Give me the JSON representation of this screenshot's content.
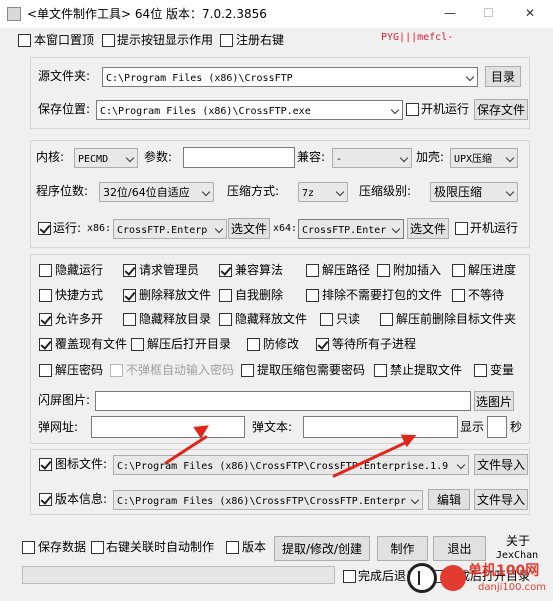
{
  "window": {
    "title": "<单文件制作工具> 64位 版本：7.0.2.3856",
    "watermark": "PYG|||mefcl-",
    "controls": {
      "minimize": "—",
      "maximize": "☐",
      "close": "✕"
    }
  },
  "top_options": {
    "topmost": "本窗口置顶",
    "tooltip": "提示按钮显示作用",
    "register_menu": "注册右键"
  },
  "source": {
    "source_label": "源文件夹:",
    "source_value": "C:\\Program Files (x86)\\CrossFTP",
    "browse_button": "目录",
    "save_label": "保存位置:",
    "save_value": "C:\\Program Files (x86)\\CrossFTP.exe",
    "autorun_label": "开机运行",
    "save_button": "保存文件"
  },
  "core": {
    "kernel_label": "内核:",
    "kernel_value": "PECMD",
    "params_label": "参数:",
    "params_value": "",
    "compat_label": "兼容:",
    "compat_value": "-",
    "shell_label": "加壳:",
    "shell_value": "UPX压缩",
    "bits_label": "程序位数:",
    "bits_value": "32位/64位自适应",
    "compress_label": "压缩方式:",
    "compress_value": "7z",
    "level_label": "压缩级别:",
    "level_value": "极限压缩",
    "run_label": "运行:",
    "x86_label": "x86:",
    "x86_value": "CrossFTP.Enterp",
    "x86_button": "选文件",
    "x64_label": "x64:",
    "x64_value": "CrossFTP.Enter",
    "x64_button": "选文件",
    "run_autorun": "开机运行"
  },
  "options": {
    "hide_run": "隐藏运行",
    "request_admin": "请求管理员",
    "compat_mode": "兼容算法",
    "extract_path": "解压路径",
    "attach_insert": "附加插入",
    "extract_progress": "解压进度",
    "shortcut": "快捷方式",
    "delete_released": "删除释放文件",
    "self_delete": "自我删除",
    "exclude_subpkg": "排除不需要打包的文件",
    "no_wait": "不等待",
    "allow_multi": "允许多开",
    "hide_release_dir": "隐藏释放目录",
    "hide_release_file": "隐藏释放文件",
    "read_only": "只读",
    "delete_target_before": "解压前删除目标文件夹",
    "overwrite": "覆盖现有文件",
    "open_dir_after": "解压后打开目录",
    "anti_change": "防修改",
    "wait_children": "等待所有子进程",
    "extract_password": "解压密码",
    "no_popup_password": "不弹框自动输入密码",
    "extract_needs_password": "提取压缩包需要密码",
    "forbid_extract": "禁止提取文件",
    "variable": "变量"
  },
  "splash": {
    "flash_label": "闪屏图片:",
    "flash_value": "",
    "flash_button": "选图片",
    "popup_url_label": "弹网址:",
    "popup_url_value": "",
    "popup_text_label": "弹文本:",
    "popup_text_value": "",
    "show_label": "显示",
    "seconds_value": "",
    "seconds_label": "秒"
  },
  "icon": {
    "icon_label": "图标文件:",
    "icon_value": "C:\\Program Files (x86)\\CrossFTP\\CrossFTP.Enterprise.1.9",
    "icon_button": "文件导入",
    "version_label": "版本信息:",
    "version_value": "C:\\Program Files (x86)\\CrossFTP\\CrossFTP.Enterpr",
    "edit_button": "编辑",
    "version_button": "文件导入"
  },
  "footer": {
    "save_data": "保存数据",
    "right_menu_auto": "右键关联时自动制作",
    "version": "版本",
    "extract_button": "提取/修改/创建",
    "make_button": "制作",
    "exit_button": "退出",
    "about_line1": "关于",
    "about_line2": "JexChan",
    "finish_exit": "完成后退出",
    "finish_open": "完成后打开目录",
    "site_watermark": "单机100网",
    "site_url": "danji100.com"
  },
  "colors": {
    "accent_red": "#e0261b",
    "window_bg": "#f0f0f0",
    "watermark_red": "#e01e2a"
  }
}
